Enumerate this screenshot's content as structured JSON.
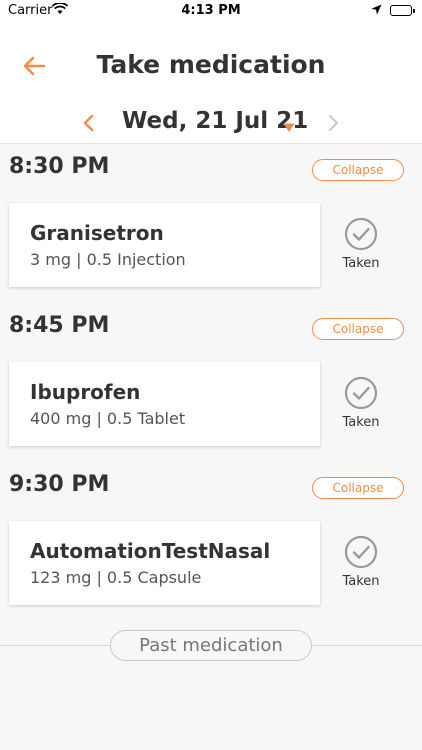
{
  "status_bar": {
    "carrier": "Carrier",
    "time": "4:13 PM"
  },
  "header": {
    "title": "Take medication",
    "date": "Wed, 21 Jul 21"
  },
  "groups": [
    {
      "time": "8:30 PM",
      "collapse_label": "Collapse",
      "medication": {
        "name": "Granisetron",
        "dose": "3 mg | 0.5 Injection",
        "status": "Taken"
      }
    },
    {
      "time": "8:45 PM",
      "collapse_label": "Collapse",
      "medication": {
        "name": "Ibuprofen",
        "dose": "400 mg | 0.5 Tablet",
        "status": "Taken"
      }
    },
    {
      "time": "9:30 PM",
      "collapse_label": "Collapse",
      "medication": {
        "name": "AutomationTestNasal",
        "dose": "123 mg | 0.5 Capsule",
        "status": "Taken"
      }
    }
  ],
  "past_medication_label": "Past medication",
  "colors": {
    "accent": "#f08c4a",
    "text": "#333333",
    "background": "#f7f7f7",
    "check": "#9a9a9a"
  },
  "icons": {
    "back": "arrow-left-icon",
    "prev": "chevron-left-icon",
    "next": "chevron-right-icon",
    "caret": "caret-down-icon",
    "taken": "check-circle-icon"
  }
}
